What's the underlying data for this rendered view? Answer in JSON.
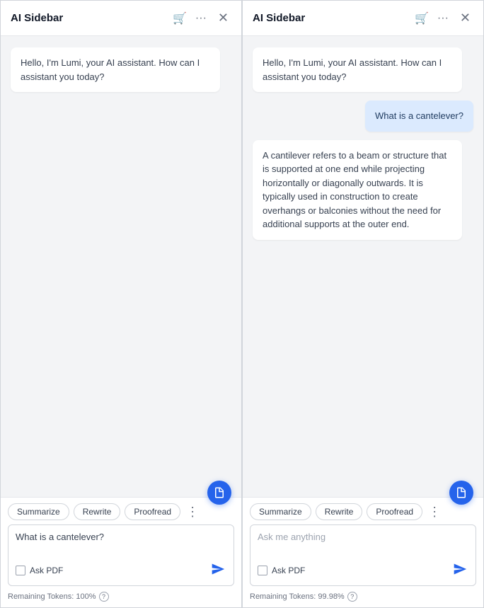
{
  "sidebars": [
    {
      "id": "left",
      "title": "AI Sidebar",
      "messages": [
        {
          "role": "assistant",
          "text": "Hello, I'm Lumi, your AI assistant. How can I assistant you today?"
        }
      ],
      "quick_actions": [
        "Summarize",
        "Rewrite",
        "Proofread"
      ],
      "input_value": "What is a cantelever?",
      "input_placeholder": "Ask me anything",
      "ask_pdf_label": "Ask PDF",
      "tokens_label": "Remaining Tokens: 100%",
      "help_label": "?"
    },
    {
      "id": "right",
      "title": "AI Sidebar",
      "messages": [
        {
          "role": "assistant",
          "text": "Hello, I'm Lumi, your AI assistant. How can I assistant you today?"
        },
        {
          "role": "user",
          "text": "What is a cantelever?"
        },
        {
          "role": "assistant",
          "text": "A cantilever refers to a beam or structure that is supported at one end while projecting horizontally or diagonally outwards. It is typically used in construction to create overhangs or balconies without the need for additional supports at the outer end."
        }
      ],
      "quick_actions": [
        "Summarize",
        "Rewrite",
        "Proofread"
      ],
      "input_value": "",
      "input_placeholder": "Ask me anything",
      "ask_pdf_label": "Ask PDF",
      "tokens_label": "Remaining Tokens: 99.98%",
      "help_label": "?"
    }
  ],
  "icons": {
    "cart": "🛒",
    "more": "···",
    "close": "✕",
    "more_vert": "⋮"
  }
}
